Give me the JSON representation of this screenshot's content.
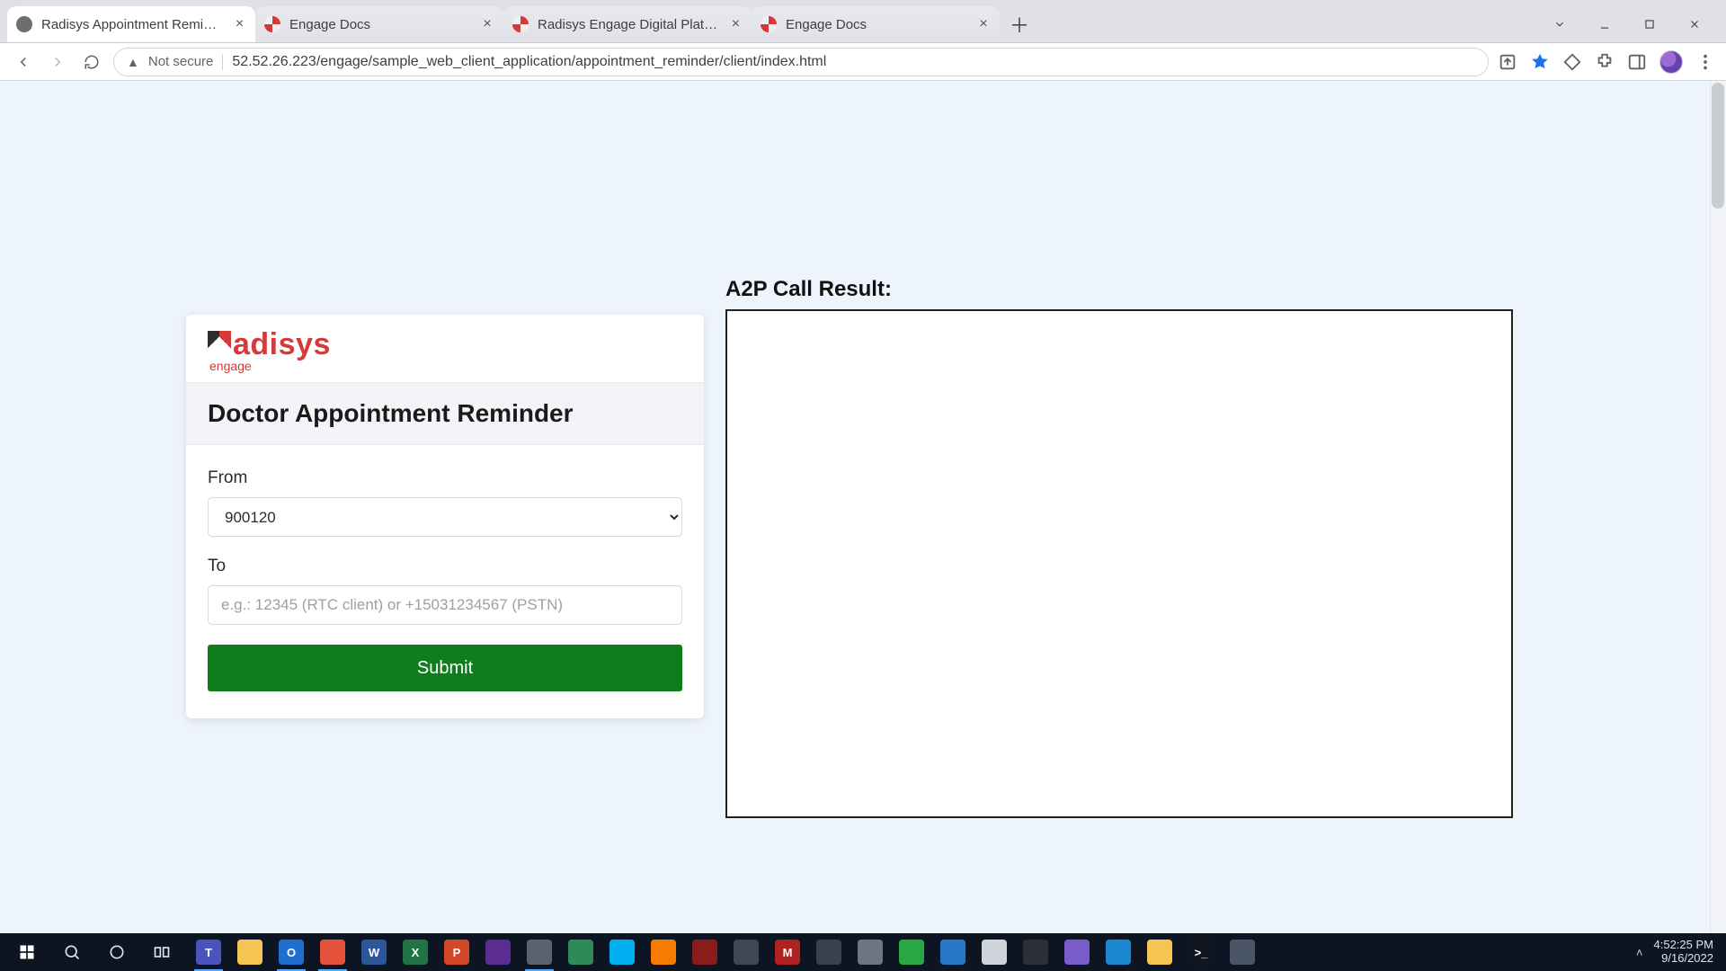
{
  "browser": {
    "tabs": [
      {
        "title": "Radisys Appointment Reminder |",
        "favicon": "globe",
        "active": true
      },
      {
        "title": "Engage Docs",
        "favicon": "swirl",
        "active": false
      },
      {
        "title": "Radisys Engage Digital Platform",
        "favicon": "swirl",
        "active": false
      },
      {
        "title": "Engage Docs",
        "favicon": "swirl",
        "active": false
      }
    ],
    "not_secure_label": "Not secure",
    "url": "52.52.26.223/engage/sample_web_client_application/appointment_reminder/client/index.html"
  },
  "page": {
    "logo": {
      "word": "adisys",
      "sub": "engage"
    },
    "card_title": "Doctor Appointment Reminder",
    "from_label": "From",
    "from_value": "900120",
    "to_label": "To",
    "to_placeholder": "e.g.: 12345 (RTC client) or +15031234567 (PSTN)",
    "submit_label": "Submit",
    "result_title": "A2P Call Result:"
  },
  "taskbar": {
    "apps": [
      {
        "name": "teams",
        "bg": "#4b53bc",
        "txt": "T",
        "active": true
      },
      {
        "name": "file-explorer",
        "bg": "#f5c453",
        "txt": "",
        "active": false
      },
      {
        "name": "outlook",
        "bg": "#1f6fd0",
        "txt": "O",
        "active": true
      },
      {
        "name": "chrome",
        "bg": "#e5533d",
        "txt": "",
        "active": true
      },
      {
        "name": "word",
        "bg": "#2b579a",
        "txt": "W",
        "active": false
      },
      {
        "name": "excel",
        "bg": "#217346",
        "txt": "X",
        "active": false
      },
      {
        "name": "powerpoint",
        "bg": "#d24726",
        "txt": "P",
        "active": false
      },
      {
        "name": "visual-studio",
        "bg": "#5c2d91",
        "txt": "",
        "active": false
      },
      {
        "name": "app-gray-1",
        "bg": "#5a6270",
        "txt": "",
        "active": true
      },
      {
        "name": "app-green-globe",
        "bg": "#2e8b57",
        "txt": "",
        "active": false
      },
      {
        "name": "skype",
        "bg": "#00aff0",
        "txt": "",
        "active": false
      },
      {
        "name": "app-orange",
        "bg": "#f57c00",
        "txt": "",
        "active": false
      },
      {
        "name": "app-red-star",
        "bg": "#8a1c1c",
        "txt": "",
        "active": false
      },
      {
        "name": "app-camera",
        "bg": "#3f4756",
        "txt": "",
        "active": false
      },
      {
        "name": "app-red-m",
        "bg": "#b02121",
        "txt": "M",
        "active": false
      },
      {
        "name": "app-gear",
        "bg": "#394150",
        "txt": "",
        "active": false
      },
      {
        "name": "app-db",
        "bg": "#6d7585",
        "txt": "",
        "active": false
      },
      {
        "name": "app-cube",
        "bg": "#29a745",
        "txt": "",
        "active": false
      },
      {
        "name": "vscode",
        "bg": "#2978c8",
        "txt": "",
        "active": false
      },
      {
        "name": "app-circle",
        "bg": "#cfd3da",
        "txt": "",
        "active": false
      },
      {
        "name": "app-dark-o",
        "bg": "#2b2f37",
        "txt": "",
        "active": false
      },
      {
        "name": "app-tiles",
        "bg": "#7a5cc9",
        "txt": "",
        "active": false
      },
      {
        "name": "edge",
        "bg": "#1b88d4",
        "txt": "",
        "active": false
      },
      {
        "name": "app-folder2",
        "bg": "#f5c453",
        "txt": "",
        "active": false
      },
      {
        "name": "terminal",
        "bg": "#12161f",
        "txt": ">_",
        "active": false
      },
      {
        "name": "app-mixed",
        "bg": "#4a5568",
        "txt": "",
        "active": false
      }
    ],
    "time": "4:52:25 PM",
    "date": "9/16/2022"
  }
}
